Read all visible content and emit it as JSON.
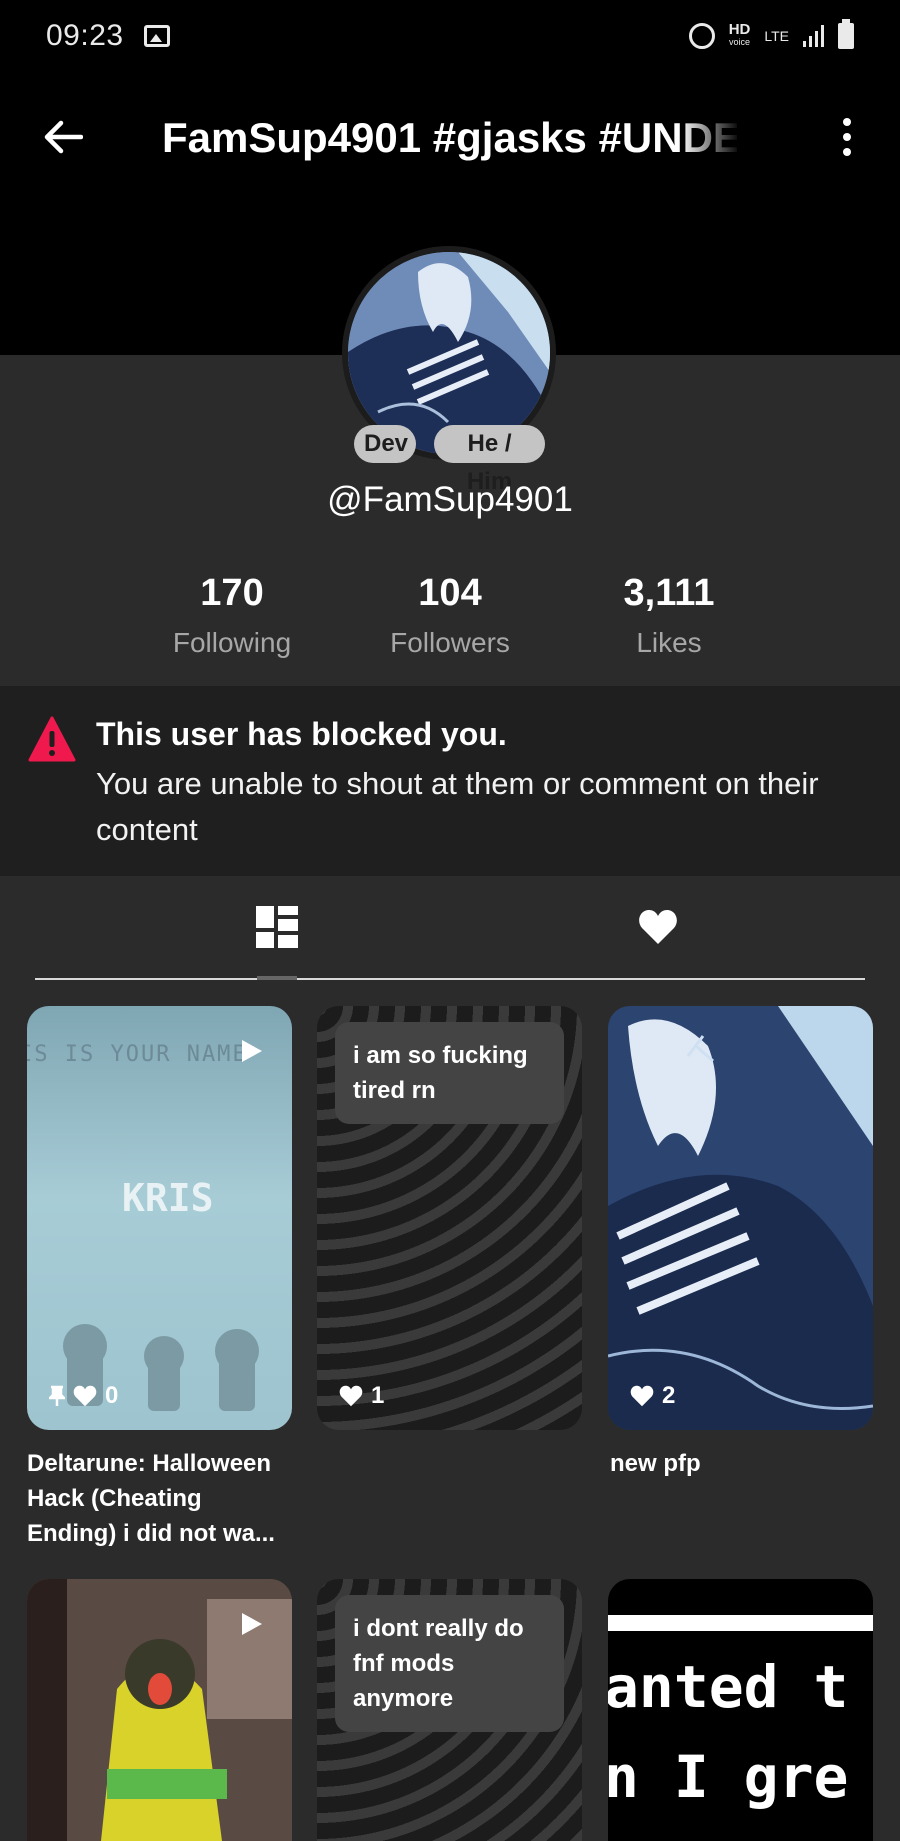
{
  "status_bar": {
    "time": "09:23",
    "hd": "HD",
    "hd_sub": "voice",
    "lte": "LTE"
  },
  "header": {
    "title": "FamSup4901 #gjasks #UNDE"
  },
  "profile": {
    "badges": [
      "Dev",
      "He / Him"
    ],
    "handle": "@FamSup4901",
    "stats": [
      {
        "value": "170",
        "label": "Following"
      },
      {
        "value": "104",
        "label": "Followers"
      },
      {
        "value": "3,111",
        "label": "Likes"
      }
    ]
  },
  "blocked_notice": {
    "title": "This user has blocked you.",
    "text": "You are unable to shout at them or comment on their content"
  },
  "posts": [
    {
      "type": "video",
      "likes": "0",
      "pinned": true,
      "caption": "Deltarune: Halloween Hack (Cheating Ending) i did not wa...",
      "overlay_top": "IS IS YOUR NAME",
      "overlay_name": "KRIS"
    },
    {
      "type": "text",
      "likes": "1",
      "text": "i am so fucking tired rn"
    },
    {
      "type": "image",
      "likes": "2",
      "caption": "new pfp"
    },
    {
      "type": "video",
      "likes": ""
    },
    {
      "type": "text",
      "likes": "",
      "text": "i dont really do fnf mods anymore"
    },
    {
      "type": "image",
      "overlay_line1": "anted t",
      "overlay_line2": "n I gre"
    }
  ],
  "colors": {
    "accent_warning": "#f0194e",
    "header_bg": "#000000",
    "page_bg": "#2b2b2b",
    "banner_bg": "#1f1f1f"
  }
}
